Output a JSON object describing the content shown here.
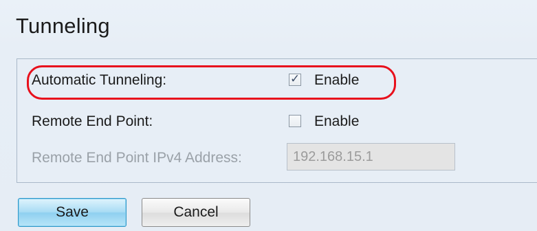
{
  "page": {
    "title": "Tunneling"
  },
  "form": {
    "automatic_tunneling": {
      "label": "Automatic Tunneling:",
      "checked": true,
      "option_label": "Enable"
    },
    "remote_end_point": {
      "label": "Remote End Point:",
      "checked": false,
      "option_label": "Enable"
    },
    "remote_ipv4": {
      "label": "Remote End Point IPv4 Address:",
      "value": "192.168.15.1",
      "disabled": true
    }
  },
  "buttons": {
    "save_label": "Save",
    "cancel_label": "Cancel"
  },
  "colors": {
    "highlight": "#e8101c",
    "save_button": "#a9dcf4",
    "panel_border": "#a9b8c8"
  }
}
